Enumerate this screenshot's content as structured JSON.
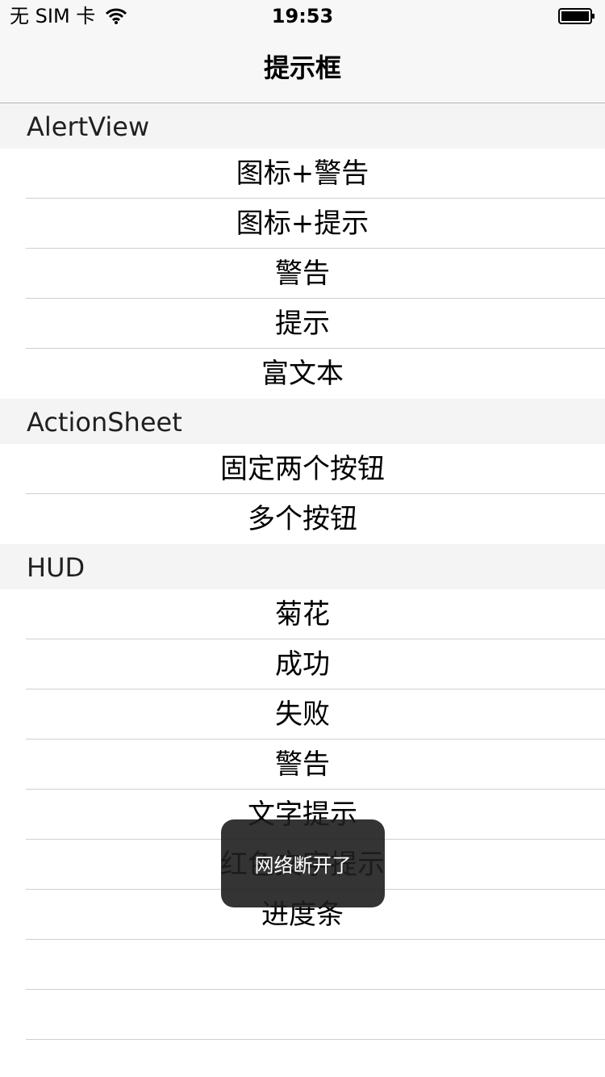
{
  "status_bar": {
    "carrier": "无 SIM 卡",
    "time": "19:53"
  },
  "nav": {
    "title": "提示框"
  },
  "sections": [
    {
      "header": "AlertView",
      "rows": [
        "图标+警告",
        "图标+提示",
        "警告",
        "提示",
        "富文本"
      ]
    },
    {
      "header": "ActionSheet",
      "rows": [
        "固定两个按钮",
        "多个按钮"
      ]
    },
    {
      "header": "HUD",
      "rows": [
        "菊花",
        "成功",
        "失败",
        "警告",
        "文字提示",
        "红色文字提示",
        "进度条",
        "",
        ""
      ]
    }
  ],
  "toast": {
    "message": "网络断开了"
  }
}
